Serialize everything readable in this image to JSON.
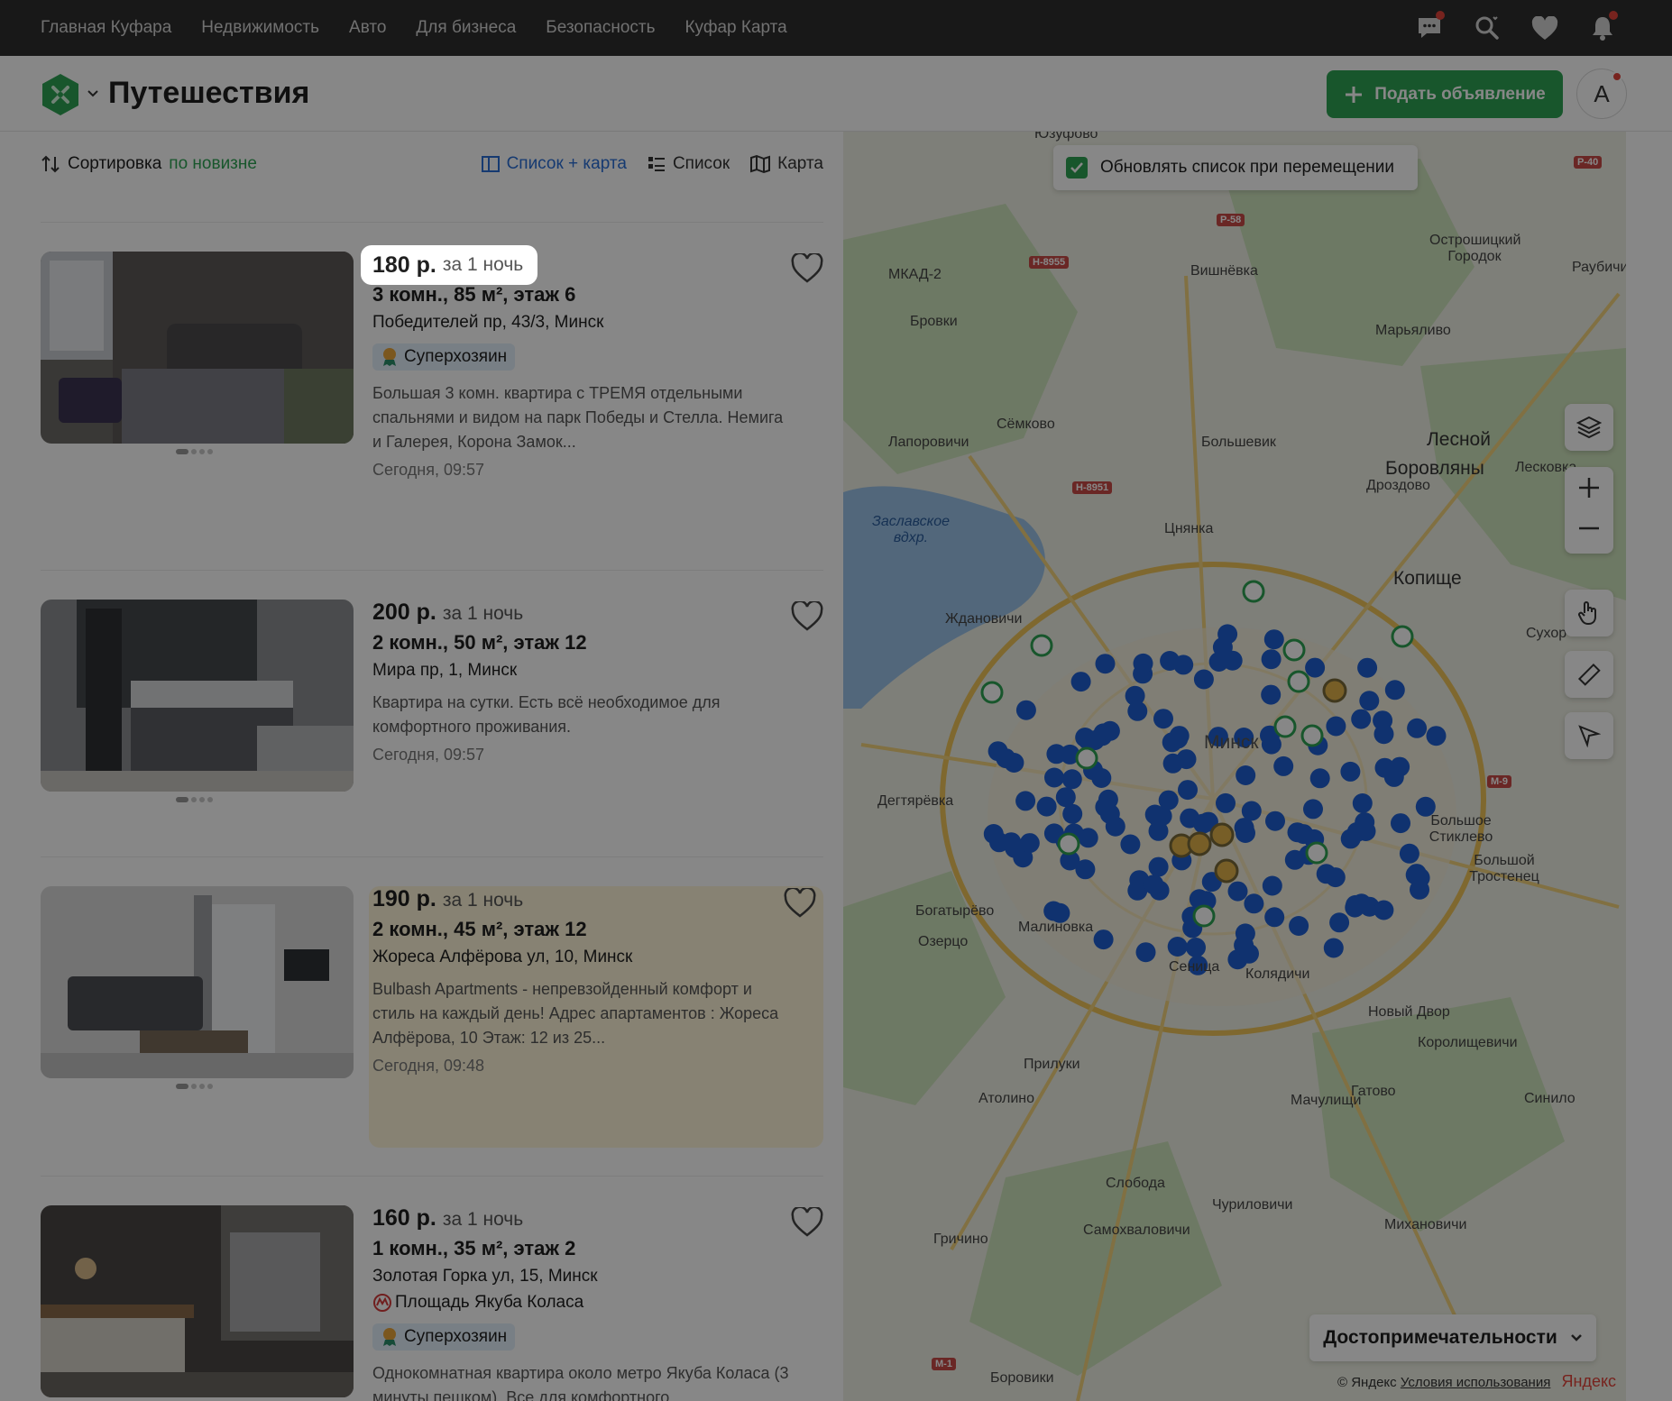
{
  "topnav": {
    "links": [
      "Главная Куфара",
      "Недвижимость",
      "Авто",
      "Для бизнеса",
      "Безопасность",
      "Куфар Карта"
    ],
    "icons": [
      "chat-icon",
      "saved-search-icon",
      "heart-icon",
      "bell-icon"
    ]
  },
  "header": {
    "title": "Путешествия",
    "post_button": "Подать объявление",
    "avatar_letter": "A"
  },
  "toolbar": {
    "sort_label": "Сортировка",
    "sort_value": "по новизне",
    "views": [
      "Список + карта",
      "Список",
      "Карта"
    ],
    "active_view": "Список + карта"
  },
  "listings": [
    {
      "price": "180 р.",
      "per": "за 1 ночь",
      "specs": "3 комн., 85 м², этаж 6",
      "address": "Победителей пр, 43/3, Минск",
      "badge": "Суперхозяин",
      "description": "Большая 3 комн. квартира с ТРЕМЯ отдельными спальнями и видом на парк Победы и Стелла. Немига и Галерея, Корона Замок...",
      "time": "Сегодня, 09:57"
    },
    {
      "price": "200 р.",
      "per": "за 1 ночь",
      "specs": "2 комн., 50 м², этаж 12",
      "address": "Мира пр, 1, Минск",
      "description": "Квартира на сутки. Есть всё необходимое для комфортного проживания.",
      "time": "Сегодня, 09:57"
    },
    {
      "price": "190 р.",
      "per": "за 1 ночь",
      "specs": "2 комн., 45 м², этаж 12",
      "address": "Жореса Алфёрова ул, 10, Минск",
      "description": "Bulbash Apartments - непревзойденный комфорт и стиль на каждый день! Адрес апартаментов : Жореса Алфёрова, 10 Этаж: 12 из 25...",
      "time": "Сегодня, 09:48"
    },
    {
      "price": "160 р.",
      "per": "за 1 ночь",
      "specs": "1 комн., 35 м², этаж 2",
      "address": "Золотая Горка ул, 15, Минск",
      "metro": "Площадь Якуба Коласа",
      "badge": "Суперхозяин",
      "description": "Однокомнатная квартира около метро Якуба Коласа (3 минуты пешком). Все для комфортного"
    }
  ],
  "map": {
    "update_checkbox": "Обновлять список при перемещении",
    "attractions": "Достопримечательности",
    "copyright": "© Яндекс",
    "terms": "Условия использования",
    "brand": "Яндекс",
    "labels": {
      "yuzufovo": "Юзуфово",
      "mkad2": "МКАД-2",
      "vishnyovka": "Вишнёвка",
      "ostroshitsky": "Острошицкий Городок",
      "raubichi": "Раубичи",
      "brovki": "Бровки",
      "maryalivo": "Марьяливо",
      "semkovo": "Сёмково",
      "lesnoy": "Лесной",
      "lapo": "Лапоровичи",
      "bolshevik": "Большевик",
      "borovlyany": "Боровляны",
      "leskovka": "Лесковка",
      "drozdovo": "Дроздово",
      "zaslavskoe": "Заславское вдхр.",
      "tsnyanka": "Цнянка",
      "kopishche": "Копище",
      "zhdanovichi": "Ждановичи",
      "sukhor": "Сухор",
      "degtyaryovka": "Дегтярёвка",
      "bolshoe_stiklevo": "Большое Стиклево",
      "bolshoy_trostenets": "Большой Тростенец",
      "bogatyryovo": "Богатырёво",
      "malinovka": "Малиновка",
      "ozertso": "Озерцо",
      "senitsa": "Сеница",
      "kolyadichi": "Колядичи",
      "novy_dvor": "Новый Двор",
      "korolishchevichi": "Королищевичи",
      "prilugi": "Прилуки",
      "atolino": "Атолино",
      "machulishchi": "Мачулищи",
      "gatovo": "Гатово",
      "sinilo": "Синило",
      "sloboda": "Слобода",
      "churilovichi": "Чуриловичи",
      "samokhvalovichi": "Самохваловичи",
      "mikhanovichi": "Михановичи",
      "grichino": "Гричино",
      "boroviki": "Боровики",
      "minsk": "Минск"
    },
    "road_signs": [
      "Р-40",
      "Р-58",
      "Н-8955",
      "Н-8951",
      "М-9",
      "М-1"
    ]
  },
  "colors": {
    "topnav_bg": "#2e2e2e",
    "brand_green": "#2ea354",
    "link_blue": "#2a6fd6",
    "marker_blue": "#1f5fd1",
    "badge_bg": "#e3f0fb",
    "promo_bg": "#fff6d9"
  }
}
